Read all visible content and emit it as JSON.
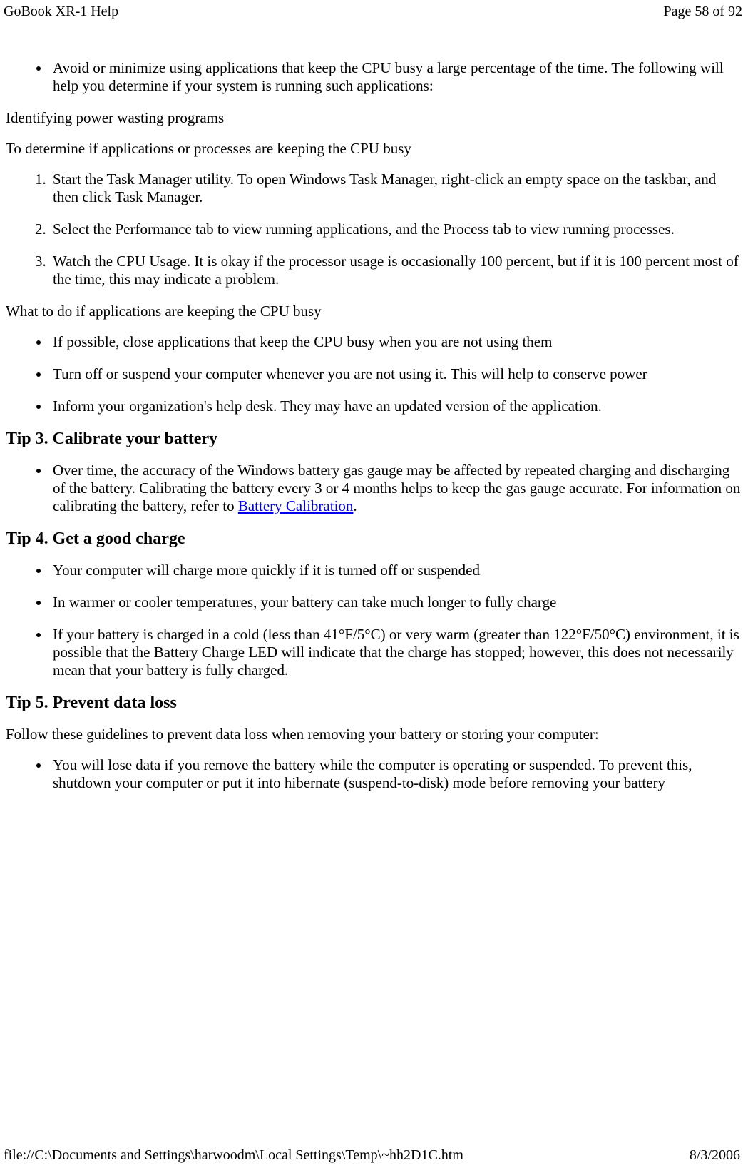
{
  "header": {
    "title": "GoBook XR-1 Help",
    "page": "Page 58 of 92"
  },
  "footer": {
    "path": "file://C:\\Documents and Settings\\harwoodm\\Local Settings\\Temp\\~hh2D1C.htm",
    "date": "8/3/2006"
  },
  "body": {
    "intro_bullet": "Avoid or minimize using applications that keep the CPU busy a large percentage of the time. The following will help you determine if your system is running such applications:",
    "identifying_heading": "Identifying power wasting programs",
    "identifying_para": "To determine if applications or processes are keeping the CPU busy",
    "steps": [
      "Start the Task Manager utility. To open Windows Task Manager, right-click an empty space on the taskbar, and then click Task Manager.",
      "Select the Performance tab to view running applications, and the Process tab to view running processes.",
      "Watch the CPU Usage. It is okay if the processor usage is occasionally 100 percent, but if it is 100 percent most of the time, this may indicate a problem."
    ],
    "whattodo_heading": "What to do if applications are keeping the CPU busy",
    "whattodo_bullets": [
      "If possible, close applications that keep the CPU busy when you are not using them",
      "Turn off or suspend your computer whenever you are not using it. This will help to conserve power",
      "Inform your organization's help desk. They may have an updated version of the application."
    ],
    "tip3_heading": "Tip 3. Calibrate your battery",
    "tip3_bullet_prefix": "Over time, the accuracy of the Windows battery gas gauge may be affected by repeated charging and discharging of the battery. Calibrating the battery every 3 or 4 months helps to keep the gas gauge accurate. For information on calibrating the battery, refer to ",
    "tip3_link": "Battery Calibration",
    "tip3_bullet_suffix": ".",
    "tip4_heading": "Tip 4. Get a good charge",
    "tip4_bullets": [
      "Your computer will charge more quickly if it is turned off or suspended",
      "In warmer or cooler temperatures, your battery can take much longer to fully charge",
      "If your battery is charged in a cold (less than 41°F/5°C) or very warm (greater than 122°F/50°C) environment, it is possible that the Battery Charge LED will indicate that the charge has stopped; however, this does not necessarily mean that your battery is fully charged."
    ],
    "tip5_heading": "Tip 5. Prevent data loss",
    "tip5_para": "Follow these guidelines to prevent data loss when removing your battery or storing your computer:",
    "tip5_bullet": "You will lose data if you remove the battery while the computer is operating or suspended. To prevent this, shutdown your computer or put it into hibernate (suspend-to-disk) mode before removing your battery"
  }
}
